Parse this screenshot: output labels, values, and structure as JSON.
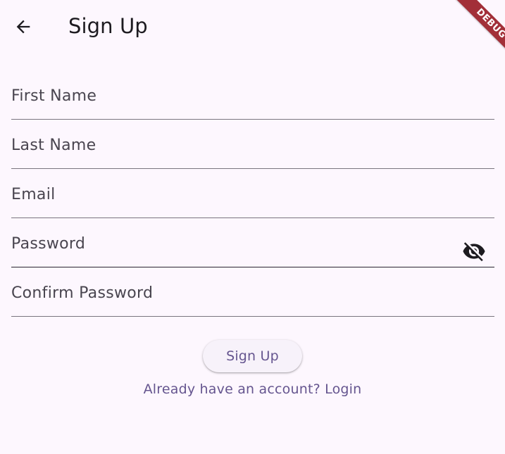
{
  "app_bar": {
    "title": "Sign Up",
    "back_icon": "arrow-back-icon"
  },
  "debug_banner": {
    "label": "DEBUG",
    "color": "#A22F38"
  },
  "form": {
    "fields": [
      {
        "label": "First Name",
        "value": ""
      },
      {
        "label": "Last Name",
        "value": ""
      },
      {
        "label": "Email",
        "value": ""
      },
      {
        "label": "Password",
        "value": "",
        "obscured": true,
        "toggle_icon": "visibility-off-icon"
      },
      {
        "label": "Confirm Password",
        "value": ""
      }
    ]
  },
  "actions": {
    "signup_label": "Sign Up",
    "login_link": "Already have an account? Login"
  },
  "colors": {
    "background": "#FDF7FE",
    "primary": "#65558F",
    "underline": "#7A757F"
  }
}
